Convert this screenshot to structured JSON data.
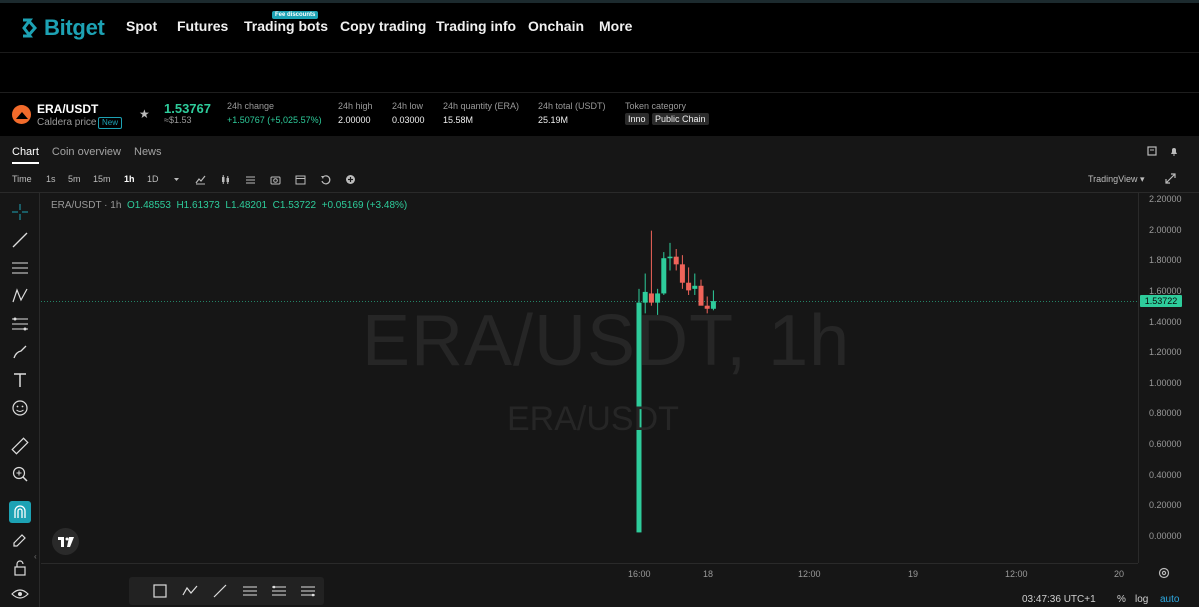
{
  "brand": {
    "name": "Bitget",
    "color": "#1da2b4"
  },
  "nav": {
    "items": [
      {
        "label": "Spot"
      },
      {
        "label": "Futures"
      },
      {
        "label": "Trading bots"
      },
      {
        "label": "Copy trading"
      },
      {
        "label": "Trading info"
      },
      {
        "label": "Onchain"
      },
      {
        "label": "More"
      }
    ],
    "badge": "Fee discounts"
  },
  "ticker": {
    "pair": "ERA/USDT",
    "sub_label": "Caldera price",
    "new_badge": "New",
    "last_price": "1.53767",
    "last_fiat": "≈$1.53",
    "stats": [
      {
        "label": "24h change",
        "value": "+1.50767 (+5,025.57%)",
        "up": true
      },
      {
        "label": "24h high",
        "value": "2.00000"
      },
      {
        "label": "24h low",
        "value": "0.03000"
      },
      {
        "label": "24h quantity (ERA)",
        "value": "15.58M"
      },
      {
        "label": "24h total (USDT)",
        "value": "25.19M"
      }
    ],
    "category_label": "Token category",
    "tags": [
      "Inno",
      "Public Chain"
    ]
  },
  "tabs": [
    "Chart",
    "Coin overview",
    "News"
  ],
  "active_tab": "Chart",
  "toolbar": {
    "time_label": "Time",
    "timeframes": [
      "1s",
      "5m",
      "15m",
      "1h",
      "1D"
    ],
    "active_timeframe": "1h",
    "view_mode": "TradingView"
  },
  "legend": {
    "symbol": "ERA/USDT · 1h",
    "open": "O1.48553",
    "high": "H1.61373",
    "low": "L1.48201",
    "close": "C1.53722",
    "change": "+0.05169 (+3.48%)"
  },
  "watermark": {
    "big": "ERA/USDT, 1h",
    "small": "ERA/USDT"
  },
  "chart_data": {
    "type": "candlestick",
    "y_ticks": [
      "2.20000",
      "2.00000",
      "1.80000",
      "1.60000",
      "1.40000",
      "1.20000",
      "1.00000",
      "0.80000",
      "0.60000",
      "0.40000",
      "0.20000",
      "0.00000"
    ],
    "ylim": [
      0.0,
      2.2
    ],
    "x_ticks": [
      "16:00",
      "18",
      "12:00",
      "19",
      "12:00",
      "20"
    ],
    "current_price": "1.53722",
    "current_value": 1.53722,
    "up_color": "#2ecc9b",
    "down_color": "#f0645a",
    "candles": [
      {
        "o": 0.03,
        "h": 1.62,
        "l": 0.03,
        "c": 1.53
      },
      {
        "o": 1.53,
        "h": 1.72,
        "l": 1.46,
        "c": 1.6
      },
      {
        "o": 1.59,
        "h": 2.0,
        "l": 1.51,
        "c": 1.53
      },
      {
        "o": 1.53,
        "h": 1.62,
        "l": 1.45,
        "c": 1.59
      },
      {
        "o": 1.59,
        "h": 1.86,
        "l": 1.58,
        "c": 1.82
      },
      {
        "o": 1.82,
        "h": 1.92,
        "l": 1.74,
        "c": 1.83
      },
      {
        "o": 1.83,
        "h": 1.88,
        "l": 1.74,
        "c": 1.78
      },
      {
        "o": 1.78,
        "h": 1.84,
        "l": 1.62,
        "c": 1.66
      },
      {
        "o": 1.66,
        "h": 1.76,
        "l": 1.58,
        "c": 1.61
      },
      {
        "o": 1.62,
        "h": 1.72,
        "l": 1.58,
        "c": 1.64
      },
      {
        "o": 1.64,
        "h": 1.68,
        "l": 1.53,
        "c": 1.51
      },
      {
        "o": 1.51,
        "h": 1.57,
        "l": 1.46,
        "c": 1.49
      },
      {
        "o": 1.49,
        "h": 1.61,
        "l": 1.48,
        "c": 1.54
      }
    ]
  },
  "status": {
    "time": "03:47:36 UTC+1",
    "percent": "%",
    "log": "log",
    "auto": "auto"
  }
}
